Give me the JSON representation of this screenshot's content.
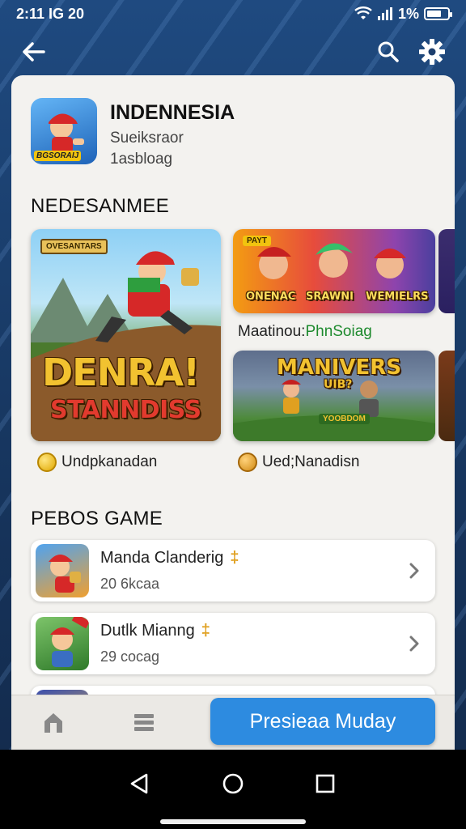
{
  "status_bar": {
    "time": "2:11 IG 20",
    "battery": "1%"
  },
  "app": {
    "title": "INDENNESIA",
    "subtitle": "Sueiksraor",
    "meta": "1asbloag",
    "icon_label": "BGSORAIJ"
  },
  "featured": {
    "section_title": "NEDESANMEE",
    "big_tile": {
      "badge": "OVESANTARS",
      "title_top": "DENRA!",
      "title_bottom": "STANNDISS"
    },
    "big_caption": "Undpkanadan",
    "top_tile": {
      "badge": "PAYT",
      "labels": [
        "ONENAC",
        "SRAWNI",
        "WEMIELRS"
      ]
    },
    "top_caption_prefix": "Maatinou: ",
    "top_caption_highlight": "PhnSoiag",
    "bottom_tile": {
      "title": "MANIVERS",
      "subtitle": "UIB?",
      "banner": "YOOBDOM"
    },
    "bottom_caption": "Ued;Nanadisn"
  },
  "list_section_title": "PEBOS GAME",
  "list": [
    {
      "name": "Manda Clanderig",
      "meta": "20 6kcaa",
      "mark": "‡"
    },
    {
      "name": "Dutlk Mianng",
      "meta": "29 cocag",
      "mark": "‡"
    }
  ],
  "cta_label": "Presieaa Muday",
  "colors": {
    "accent": "#2d8be0",
    "highlight_green": "#1e8a2e",
    "card_bg": "#f3f2ef"
  },
  "icons": [
    "back-arrow-icon",
    "search-icon",
    "gear-icon",
    "home-icon",
    "list-icon",
    "chevron-right-icon",
    "nav-back-icon",
    "nav-home-icon",
    "nav-recents-icon"
  ]
}
